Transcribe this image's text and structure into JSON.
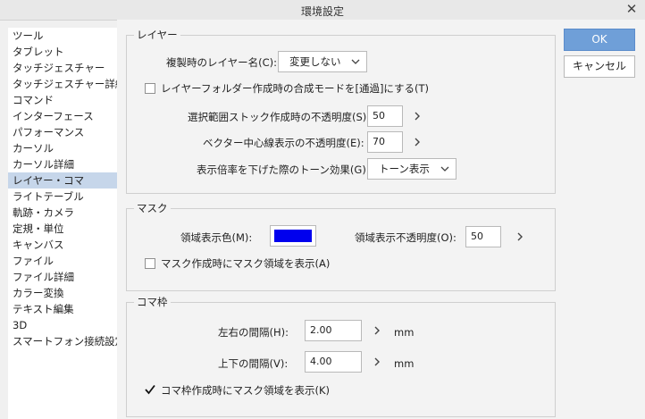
{
  "window": {
    "title": "環境設定"
  },
  "sidebar": {
    "items": [
      {
        "label": "ツール"
      },
      {
        "label": "タブレット"
      },
      {
        "label": "タッチジェスチャー"
      },
      {
        "label": "タッチジェスチャー詳細"
      },
      {
        "label": "コマンド"
      },
      {
        "label": "インターフェース"
      },
      {
        "label": "パフォーマンス"
      },
      {
        "label": "カーソル"
      },
      {
        "label": "カーソル詳細"
      },
      {
        "label": "レイヤー・コマ",
        "selected": true
      },
      {
        "label": "ライトテーブル"
      },
      {
        "label": "軌跡・カメラ"
      },
      {
        "label": "定規・単位"
      },
      {
        "label": "キャンバス"
      },
      {
        "label": "ファイル"
      },
      {
        "label": "ファイル詳細"
      },
      {
        "label": "カラー変換"
      },
      {
        "label": "テキスト編集"
      },
      {
        "label": "3D"
      },
      {
        "label": "スマートフォン接続設定"
      }
    ]
  },
  "layer": {
    "title": "レイヤー",
    "dup_name_label": "複製時のレイヤー名(C):",
    "dup_name_value": "変更しない",
    "folder_blend_label": "レイヤーフォルダー作成時の合成モードを[通過]にする(T)",
    "folder_blend_checked": false,
    "selection_opacity_label": "選択範囲ストック作成時の不透明度(S):",
    "selection_opacity_value": "50",
    "vector_opacity_label": "ベクター中心線表示の不透明度(E):",
    "vector_opacity_value": "70",
    "tone_effect_label": "表示倍率を下げた際のトーン効果(G):",
    "tone_effect_value": "トーン表示"
  },
  "mask": {
    "title": "マスク",
    "color_label": "領域表示色(M):",
    "color_value": "#0000ee",
    "opacity_label": "領域表示不透明度(O):",
    "opacity_value": "50",
    "show_on_create_label": "マスク作成時にマスク領域を表示(A)",
    "show_on_create_checked": false
  },
  "frame": {
    "title": "コマ枠",
    "lr_gap_label": "左右の間隔(H):",
    "lr_gap_value": "2.00",
    "tb_gap_label": "上下の間隔(V):",
    "tb_gap_value": "4.00",
    "unit": "mm",
    "mask_on_create_label": "コマ枠作成時にマスク領域を表示(K)",
    "mask_on_create_checked": true
  },
  "buttons": {
    "ok": "OK",
    "cancel": "キャンセル"
  },
  "colors": {
    "accent": "#6f9fd8",
    "selection": "#c6d6ea",
    "mask_color": "#0000ee"
  }
}
